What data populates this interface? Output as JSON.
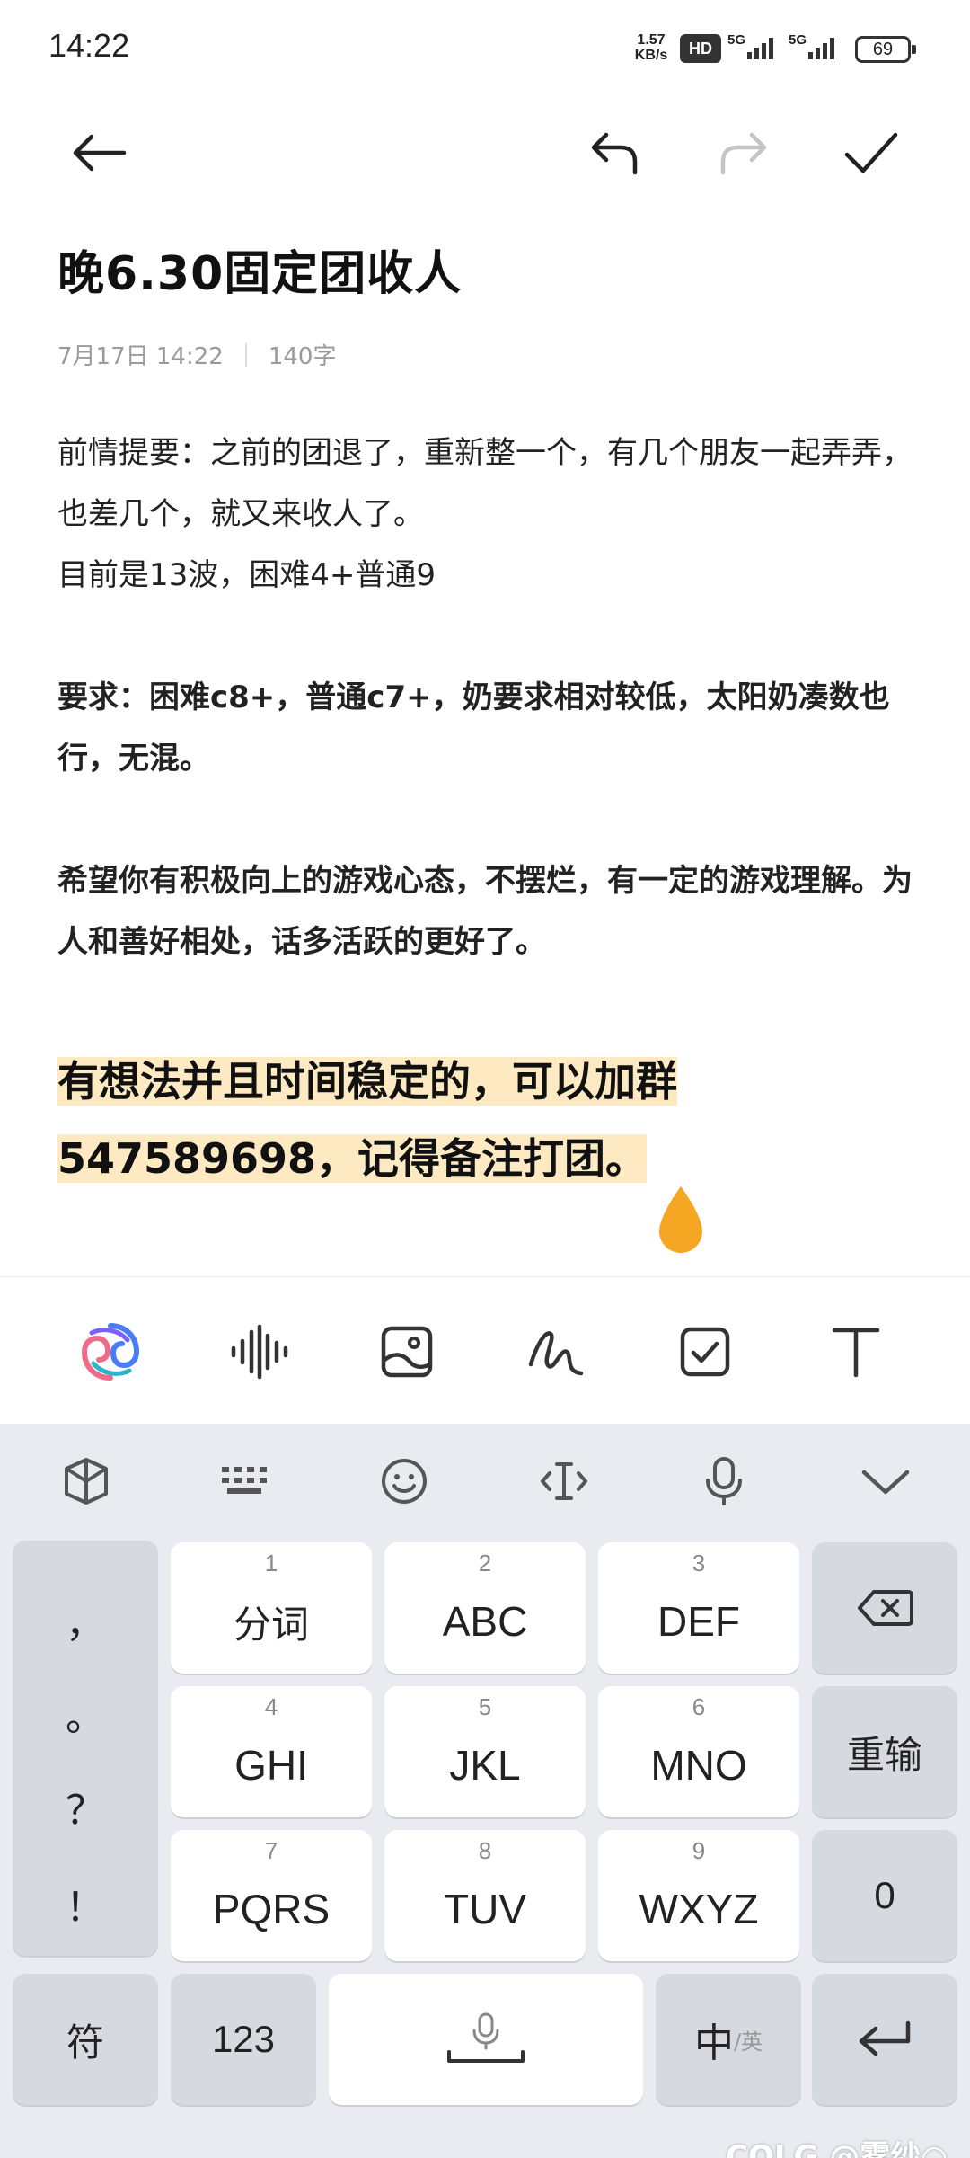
{
  "status_bar": {
    "time": "14:22",
    "net_speed_value": "1.57",
    "net_speed_unit": "KB/s",
    "hd_badge": "HD",
    "signal_1": "5G",
    "signal_2": "5G",
    "battery": "69"
  },
  "toolbar": {
    "back_icon": "arrow-left-icon",
    "undo_icon": "undo-icon",
    "redo_icon": "redo-icon",
    "done_icon": "check-icon",
    "redo_enabled": false
  },
  "note": {
    "title": "晚6.30固定团收人",
    "date": "7月17日 14:22",
    "word_count": "140字",
    "paragraphs": [
      "前情提要：之前的团退了，重新整一个，有几个朋友一起弄弄，也差几个，就又来收人了。",
      "目前是13波，困难4+普通9",
      "要求：困难c8+，普通c7+，奶要求相对较低，太阳奶凑数也行，无混。",
      "希望你有积极向上的游戏心态，不摆烂，有一定的游戏理解。为人和善好相处，话多活跃的更好了。",
      "有想法并且时间稳定的，可以加群547589698，记得备注打团。"
    ],
    "highlight_color": "#fde9c2",
    "cursor_color": "#f5a623"
  },
  "format_bar": {
    "items": [
      "ai-assistant-icon",
      "voice-waveform-icon",
      "image-icon",
      "handwriting-icon",
      "checklist-icon",
      "text-format-icon"
    ]
  },
  "keyboard": {
    "toolbar": [
      "keyboard-skin-icon",
      "keyboard-layout-icon",
      "emoji-icon",
      "text-cursor-icon",
      "microphone-icon",
      "collapse-keyboard-icon"
    ],
    "punctuation": [
      "，",
      "。",
      "？",
      "！"
    ],
    "keys": [
      {
        "num": "1",
        "label": "分词"
      },
      {
        "num": "2",
        "label": "ABC"
      },
      {
        "num": "3",
        "label": "DEF"
      },
      {
        "num": "4",
        "label": "GHI"
      },
      {
        "num": "5",
        "label": "JKL"
      },
      {
        "num": "6",
        "label": "MNO"
      },
      {
        "num": "7",
        "label": "PQRS"
      },
      {
        "num": "8",
        "label": "TUV"
      },
      {
        "num": "9",
        "label": "WXYZ"
      }
    ],
    "reinput": "重输",
    "zero": "0",
    "symbols": "符",
    "numbers": "123",
    "lang_zh": "中",
    "lang_en": "/英"
  },
  "watermark": "COLG @雾纱○"
}
